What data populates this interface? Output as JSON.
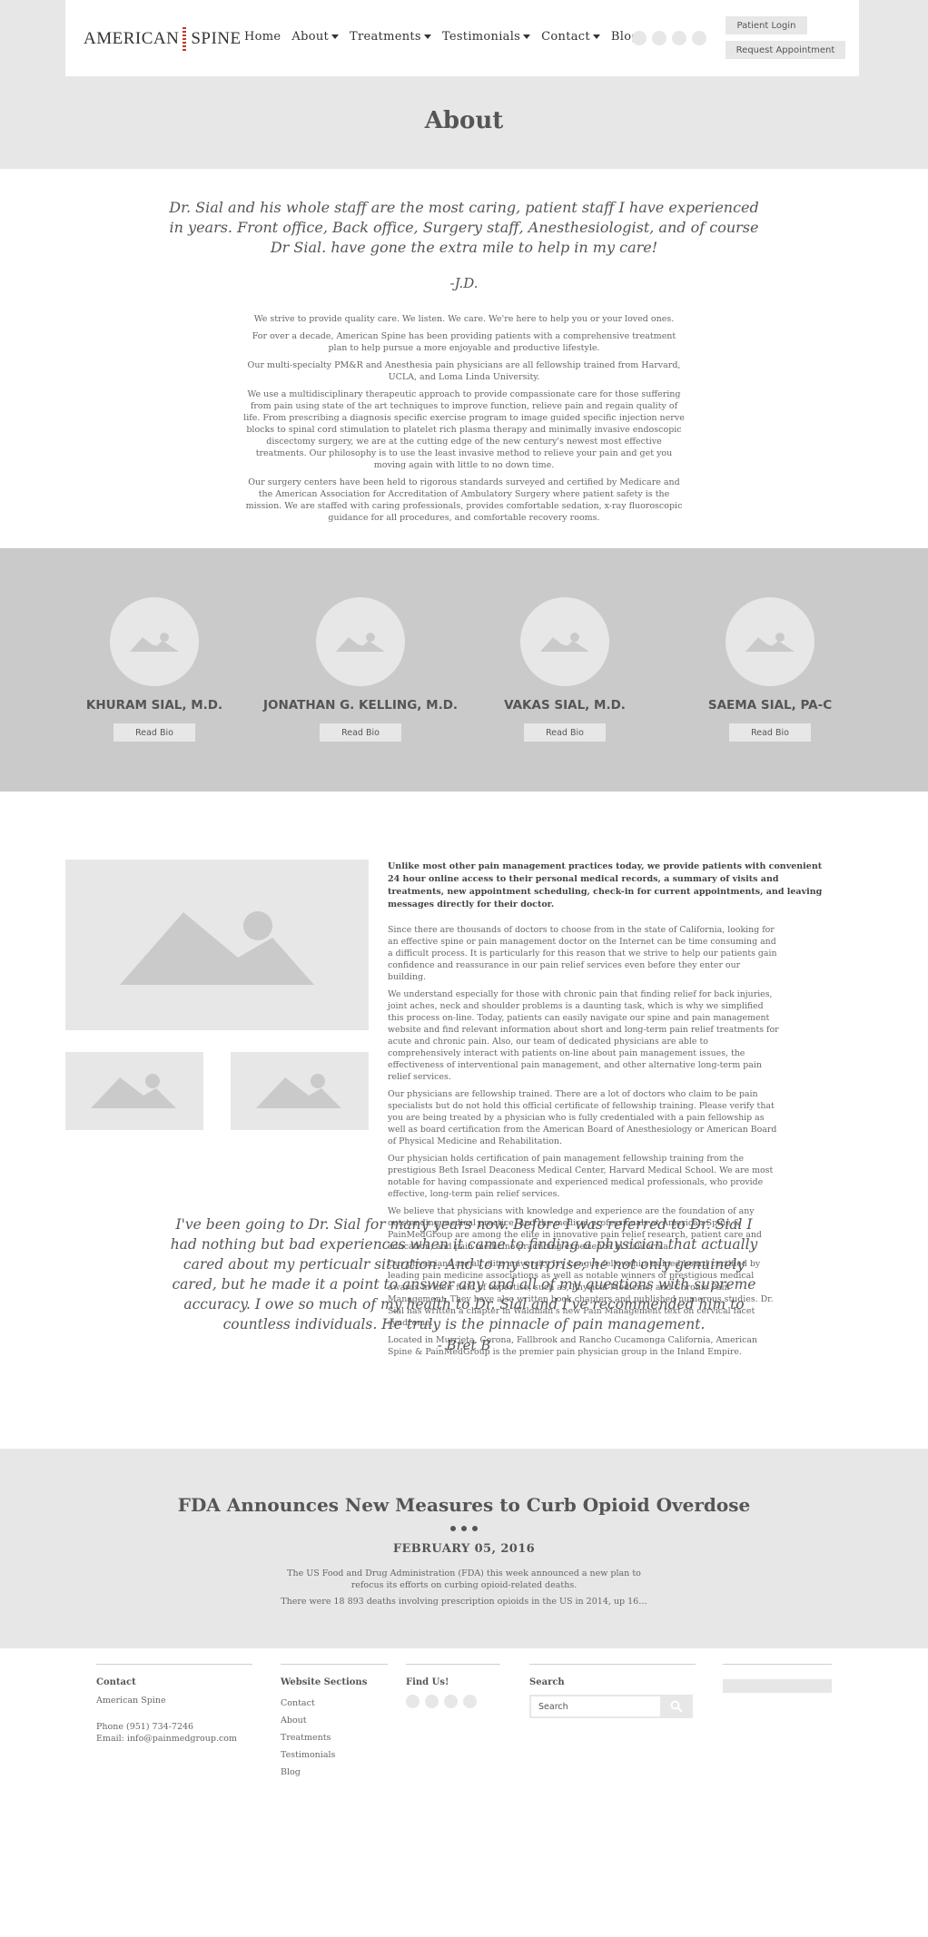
{
  "header": {
    "logo_text_left": "AMERICAN",
    "logo_text_right": "SPINE",
    "nav": [
      {
        "label": "Home"
      },
      {
        "label": "About"
      },
      {
        "label": "Treatments"
      },
      {
        "label": "Testimonials"
      },
      {
        "label": "Contact"
      },
      {
        "label": "Blog"
      }
    ],
    "patient_login": "Patient Login",
    "request_appointment": "Request Appointment"
  },
  "page": {
    "title": "About"
  },
  "intro": {
    "quote": "Dr. Sial and his whole staff are the most caring, patient staff I have experienced in years. Front office, Back office, Surgery staff, Anesthesiologist, and of course Dr Sial. have gone the extra mile to help in my care!",
    "quote_author": "-J.D.",
    "paragraphs": [
      "We strive to provide quality care. We listen. We care. We're here to help you or your loved ones.",
      "For over a decade, American Spine has been providing patients with a comprehensive treatment plan to help pursue a more enjoyable and productive lifestyle.",
      "Our multi-specialty PM&R and Anesthesia pain physicians are all fellowship trained from Harvard, UCLA, and Loma Linda University.",
      "We use a multidisciplinary therapeutic approach to provide compassionate care for those suffering from pain using state of the art techniques to improve function, relieve pain and regain quality of life. From prescribing a diagnosis specific exercise program to image guided specific injection nerve blocks to spinal cord stimulation to platelet rich plasma therapy and minimally invasive endoscopic discectomy surgery, we are at the cutting edge of the new century's newest most effective treatments. Our philosophy is to use the least invasive method to relieve your pain and get you moving again with little to no down time.",
      "Our surgery centers have been held to rigorous standards surveyed and certified by Medicare and the American Association for Accreditation of Ambulatory Surgery where patient safety is the mission. We are staffed with caring professionals, provides comfortable sedation, x-ray fluoroscopic guidance for all procedures, and comfortable recovery rooms."
    ]
  },
  "doctors": [
    {
      "name": "KHURAM SIAL, M.D.",
      "button": "Read Bio"
    },
    {
      "name": "JONATHAN G. KELLING, M.D.",
      "button": "Read Bio"
    },
    {
      "name": "VAKAS SIAL, M.D.",
      "button": "Read Bio"
    },
    {
      "name": "SAEMA SIAL, PA-C",
      "button": "Read Bio"
    }
  ],
  "about": {
    "lead": "Unlike most other pain management practices today, we provide patients with convenient 24 hour online access to their personal medical records, a summary of visits and treatments, new appointment scheduling, check-in for current appointments, and leaving messages directly for their doctor.",
    "paragraphs": [
      "Since there are thousands of doctors to choose from in the state of California, looking for an effective spine or pain management doctor on the Internet can be time consuming and a difficult process. It is particularly for this reason that we strive to help our patients gain confidence and reassurance in our pain relief services even before they enter our building.",
      "We understand especially for those with chronic pain that finding relief for back injuries, joint aches, neck and shoulder problems is a daunting task, which is why we simplified this process on-line. Today, patients can easily navigate our spine and pain management website and find relevant information about short and long-term pain relief treatments for acute and chronic pain. Also, our team of dedicated physicians are able to comprehensively interact with patients on-line about pain management issues, the effectiveness of interventional pain management, and other alternative long-term pain relief services.",
      "Our physicians are fellowship trained. There are a lot of doctors who claim to be pain specialists but do not hold this official certificate of fellowship training. Please verify that you are being treated by a physician who is fully credentialed with a pain fellowship as well as board certification from the American Board of Anesthesiology or American Board of Physical Medicine and Rehabilitation.",
      "Our physician holds certification of pain management fellowship training from the prestigious Beth Israel Deaconess Medical Center, Harvard Medical School. We are most notable for having compassionate and experienced medical professionals, who provide effective, long-term pain relief services.",
      "We believe that physicians with knowledge and experience are the foundation of any outstanding medical practice, and the medical professionals at American Spine & PainMedGroup are among the elite in innovative pain relief research, patient care and education, and pain medicine practicing experience in California.",
      "Our physicians are all elite university Ivy League fellowship trained board certified by leading pain medicine associations as well as notable winners of prestigious medical awards in their field of expertise, such as, Physical Medicine, and Chronic Pain Management. They have also written book chapters and published numerous studies. Dr. Sial has written a chapter in Waldman's new Pain Management text on cervical facet syndrome.",
      "Located in Murrieta, Corona, Fallbrook and Rancho Cucamonga California, American Spine & PainMedGroup is the premier pain physician group in the Inland Empire."
    ],
    "quote": "I've been going to Dr. Sial for many years now. Before I was referred to Dr. Sial I had nothing but bad experiences when it came to finding a physician that actually cared about my perticualr situation. And to my surprise; he not only genuinely cared, but he made it a point to answer any and all of my questions with supreme accuracy. I owe so much of my health to Dr. Sial and I've recommended him to countless individuals. He truly is the pinnacle of pain management.",
    "quote_author": "- Bret B"
  },
  "news": {
    "title": "FDA Announces New Measures to Curb Opioid Overdose",
    "date": "FEBRUARY 05, 2016",
    "p1": "The US Food and Drug Administration (FDA) this week announced a new plan to refocus its efforts on curbing opioid-related deaths.",
    "p2": "There were 18 893 deaths involving prescription opioids in the US in 2014, up 16…"
  },
  "footer": {
    "contact": {
      "heading": "Contact",
      "name": "American Spine",
      "phone": "Phone (951) 734-7246",
      "email": "Email: info@painmedgroup.com"
    },
    "sections": {
      "heading": "Website Sections",
      "links": [
        "Contact",
        "About",
        "Treatments",
        "Testimonials",
        "Blog"
      ]
    },
    "find_us": {
      "heading": "Find Us!"
    },
    "search": {
      "heading": "Search",
      "placeholder": "Search"
    }
  },
  "colors": {
    "placeholder_gray": "#e7e7e7",
    "doctors_band": "#cacaca",
    "text": "#555555",
    "logo_accent": "#c0392b"
  }
}
